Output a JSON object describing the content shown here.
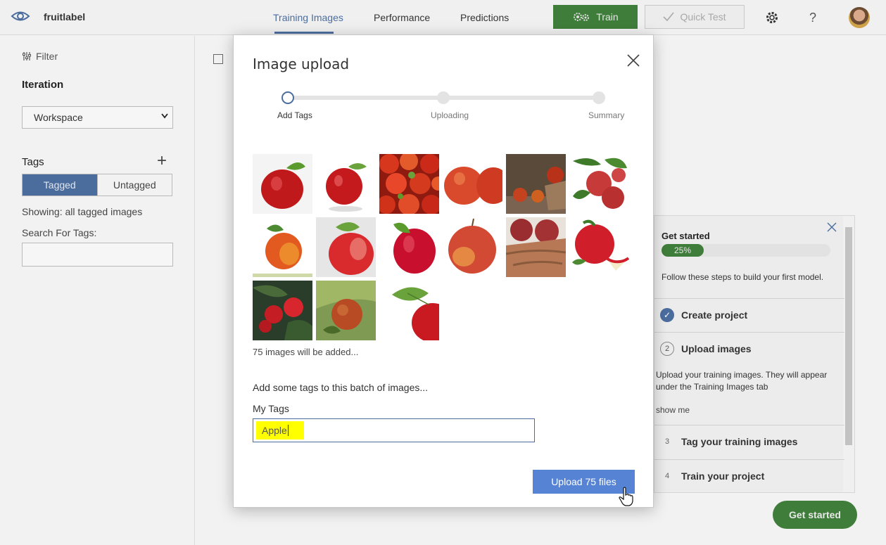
{
  "app": {
    "name": "fruitlabel"
  },
  "nav": {
    "tabs": [
      {
        "label": "Training Images",
        "active": true
      },
      {
        "label": "Performance",
        "active": false
      },
      {
        "label": "Predictions",
        "active": false
      }
    ],
    "train_label": "Train",
    "quick_test_label": "Quick Test",
    "help_glyph": "?"
  },
  "sidebar": {
    "filter_label": "Filter",
    "iteration_heading": "Iteration",
    "iteration_value": "Workspace",
    "tags_heading": "Tags",
    "tagged_label": "Tagged",
    "untagged_label": "Untagged",
    "showing_text": "Showing: all tagged images",
    "search_label": "Search For Tags:"
  },
  "get_started": {
    "title": "Get started",
    "progress_label": "25%",
    "progress_fraction": 0.25,
    "description": "Follow these steps to build your first model.",
    "steps": [
      {
        "number": "",
        "label": "Create project",
        "done": true
      },
      {
        "number": "2",
        "label": "Upload images",
        "done": false
      },
      {
        "number": "3",
        "label": "Tag your training images",
        "done": false
      },
      {
        "number": "4",
        "label": "Train your project",
        "done": false
      }
    ],
    "step2_body_line1": "Upload your training images. They will appear",
    "step2_body_line2": "under the Training Images tab",
    "show_me_label": "show me",
    "button_label": "Get started"
  },
  "modal": {
    "title": "Image upload",
    "wizard_steps": [
      {
        "label": "Add Tags",
        "state": "active"
      },
      {
        "label": "Uploading",
        "state": "todo"
      },
      {
        "label": "Summary",
        "state": "todo"
      }
    ],
    "images_count_text": "75 images will be added...",
    "tags_prompt": "Add some tags to this batch of images...",
    "my_tags_label": "My Tags",
    "tag_input_value": "Apple",
    "upload_button_label": "Upload 75 files"
  },
  "colors": {
    "accent": "#4b6d9e",
    "train_green": "#3f7d3a",
    "upload_blue": "#5683d4",
    "tag_highlight": "#ffff00"
  }
}
